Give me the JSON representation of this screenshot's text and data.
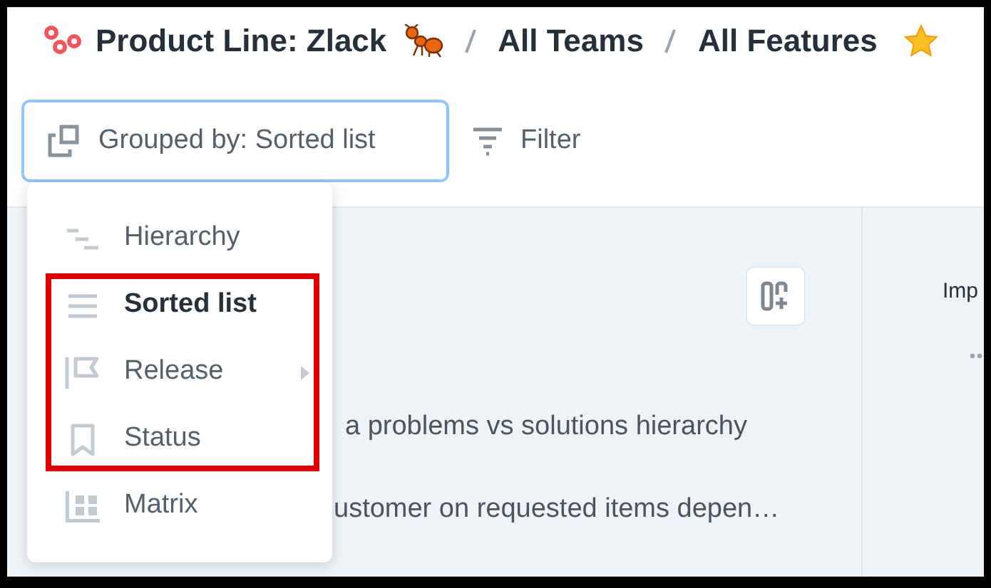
{
  "breadcrumb": [
    {
      "label": "Product Line: Zlack"
    },
    {
      "label": "All Teams"
    },
    {
      "label": "All Features"
    }
  ],
  "toolbar": {
    "group_button": "Grouped by: Sorted list",
    "filter_button": "Filter"
  },
  "group_menu": [
    {
      "label": "Hierarchy",
      "selected": false,
      "has_submenu": false,
      "highlighted": false
    },
    {
      "label": "Sorted list",
      "selected": true,
      "has_submenu": false,
      "highlighted": true
    },
    {
      "label": "Release",
      "selected": false,
      "has_submenu": true,
      "highlighted": true
    },
    {
      "label": "Status",
      "selected": false,
      "has_submenu": false,
      "highlighted": true
    },
    {
      "label": "Matrix",
      "selected": false,
      "has_submenu": false,
      "highlighted": false
    }
  ],
  "list_rows": [
    "a problems vs solutions hierarchy",
    "ustomer on requested items depen…"
  ],
  "right_panel": {
    "column_header": "Imp"
  }
}
